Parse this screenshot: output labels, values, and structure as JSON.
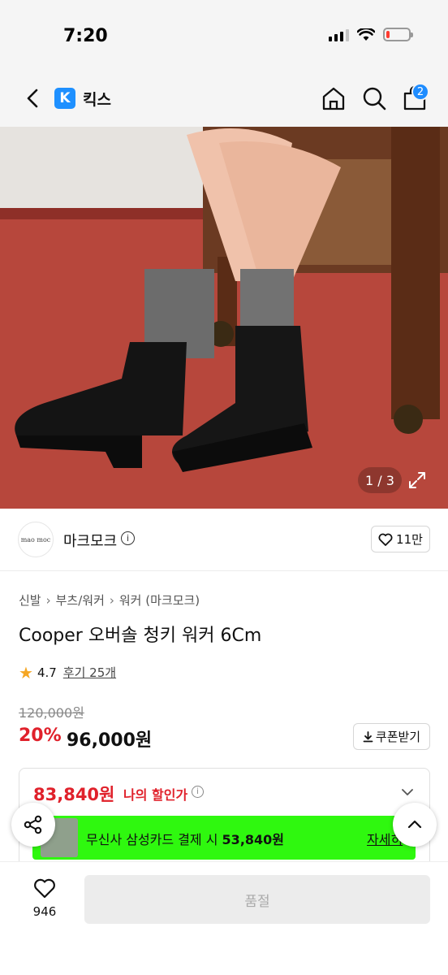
{
  "status_bar": {
    "time": "7:20"
  },
  "nav": {
    "title": "킥스",
    "logo_letter": "K",
    "cart_count": "2"
  },
  "hero": {
    "counter": "1 / 3"
  },
  "brand": {
    "logo_text": "mao moc",
    "name": "마크모크",
    "info": "i",
    "like_count": "11만"
  },
  "breadcrumb": [
    "신발",
    "부츠/워커",
    "워커 (마크모크)"
  ],
  "product": {
    "title": "Cooper 오버솔 청키 워커 6Cm",
    "rating": "4.7",
    "reviews": "후기 25개",
    "original_price": "120,000원",
    "discount_rate": "20%",
    "sale_price": "96,000원",
    "coupon_label": "쿠폰받기"
  },
  "my_discount": {
    "price": "83,840원",
    "label": "나의 할인가",
    "info": "i"
  },
  "card_banner": {
    "text_prefix": "무신사 삼성카드 결제 시 ",
    "price": "53,840원",
    "detail": "자세히"
  },
  "bottom_bar": {
    "wish_count": "946",
    "action_label": "품절"
  },
  "colors": {
    "accent_red": "#e0212b",
    "brand_blue": "#1e90ff",
    "banner_green": "#2ff80f",
    "star": "#f5a623"
  },
  "icons": [
    "back-chevron-icon",
    "home-icon",
    "search-icon",
    "cart-icon",
    "expand-icon",
    "info-icon",
    "heart-icon",
    "download-icon",
    "chevron-down-icon",
    "share-icon",
    "chevron-up-icon",
    "star-icon"
  ]
}
